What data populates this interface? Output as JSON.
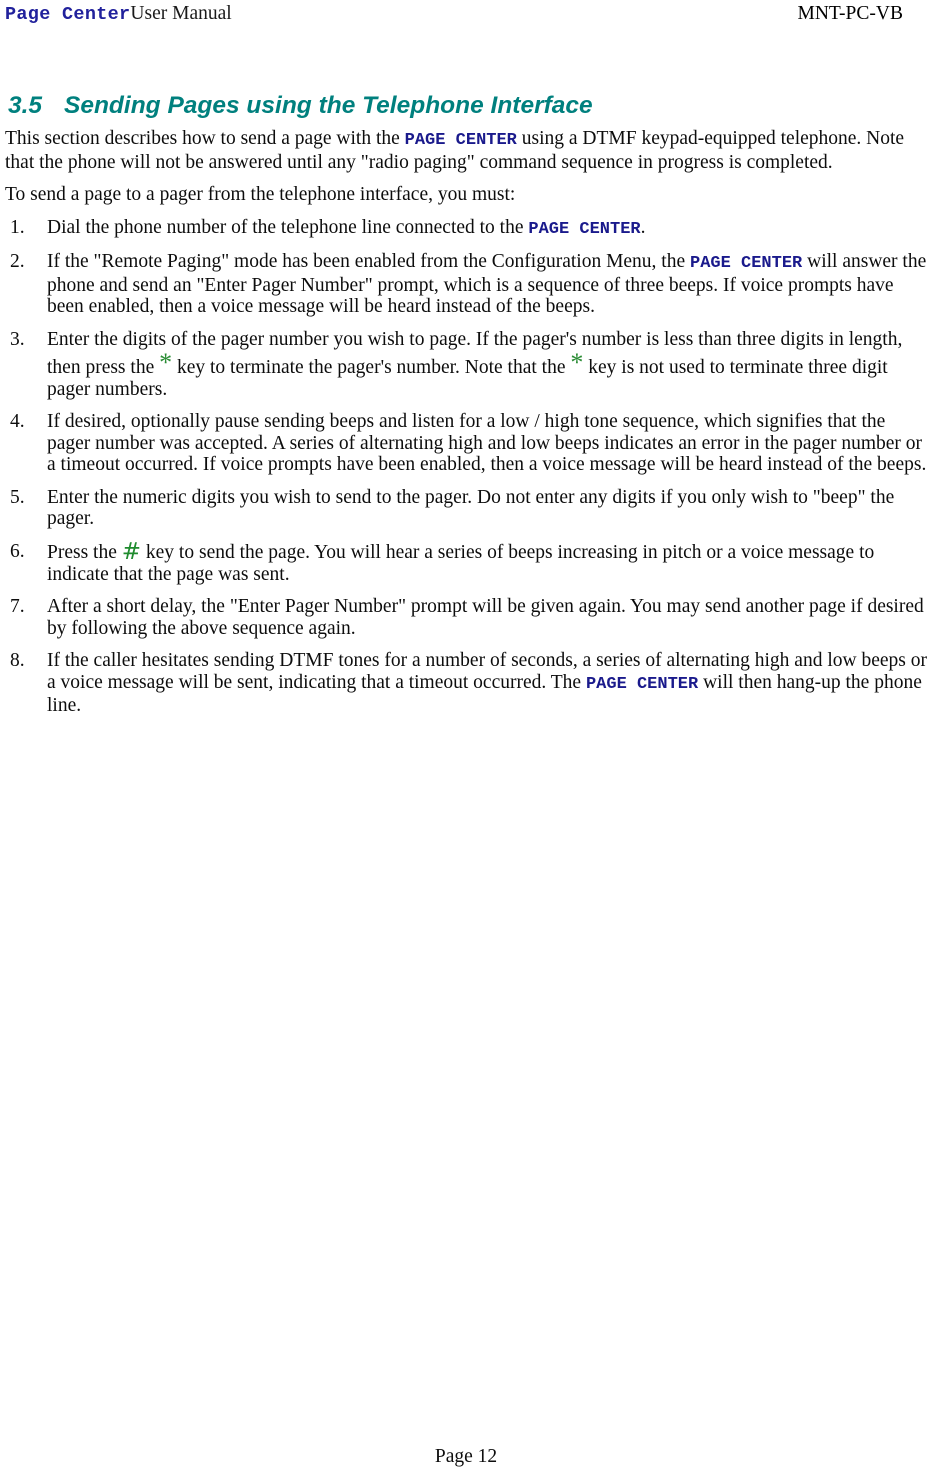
{
  "header": {
    "brand": "Page Center",
    "left_rest": "User Manual",
    "right": "MNT-PC-VB"
  },
  "heading": {
    "number": "3.5",
    "title": "Sending Pages using the Telephone Interface"
  },
  "brand_inline": "PAGE  CENTER",
  "keys": {
    "star": "*",
    "hash": "#"
  },
  "intro": {
    "p1_a": "This section describes how to send a page with the ",
    "p1_b": " using a DTMF keypad-equipped telephone. Note that the phone will not be answered until any \"radio paging\" command sequence in progress is completed.",
    "p2": "To send a page to a pager from the telephone interface, you must:"
  },
  "steps": [
    {
      "marker": "1.",
      "a": "Dial the phone number of the telephone line connected to the ",
      "b": ".",
      "c": "",
      "d": ""
    },
    {
      "marker": "2.",
      "a": "If the \"Remote Paging\" mode has been enabled from the Configuration Menu, the ",
      "b": " will answer the phone and send an \"Enter Pager Number\" prompt, which is a sequence of three beeps. If voice prompts have been enabled, then a voice message will be heard instead of the beeps.",
      "c": "",
      "d": ""
    },
    {
      "marker": "3.",
      "a": "Enter the digits of the pager number you wish to page.  If the pager's number is less than three digits in length, then press the ",
      "b": " key to terminate the pager's number.  Note that the ",
      "c": " key is not used to terminate three digit pager numbers.",
      "d": ""
    },
    {
      "marker": "4.",
      "a": "If desired, optionally pause sending beeps and listen for a low / high tone sequence, which signifies that the pager number was accepted.  A series of alternating high and low beeps indicates an error in the pager number or a timeout occurred. If voice prompts have been enabled, then a voice message will be heard instead of the beeps.",
      "b": "",
      "c": "",
      "d": ""
    },
    {
      "marker": "5.",
      "a": "Enter the numeric digits you wish to send to the pager.  Do not enter any digits if you only wish to \"beep\" the pager.",
      "b": "",
      "c": "",
      "d": ""
    },
    {
      "marker": "6.",
      "a": "Press the ",
      "b": "  key to send the page.  You will hear a series of beeps increasing in pitch or a voice message to indicate that the page was sent.",
      "c": "",
      "d": ""
    },
    {
      "marker": "7.",
      "a": "After a short delay, the \"Enter Pager Number\" prompt will be given again.  You may send another page if desired by following the above sequence again.",
      "b": "",
      "c": "",
      "d": ""
    },
    {
      "marker": "8.",
      "a": "If the caller hesitates sending DTMF tones for a number of seconds, a series of alternating high and low beeps or a voice message will be sent, indicating that a timeout occurred.  The ",
      "b": " will then hang-up the phone line.",
      "c": "",
      "d": ""
    }
  ],
  "footer": {
    "page_label": "Page 12"
  },
  "colors": {
    "brand_navy": "#000080",
    "heading_teal": "#00807e",
    "key_green": "#1f8b2e",
    "body_black": "#0d0d0d"
  }
}
